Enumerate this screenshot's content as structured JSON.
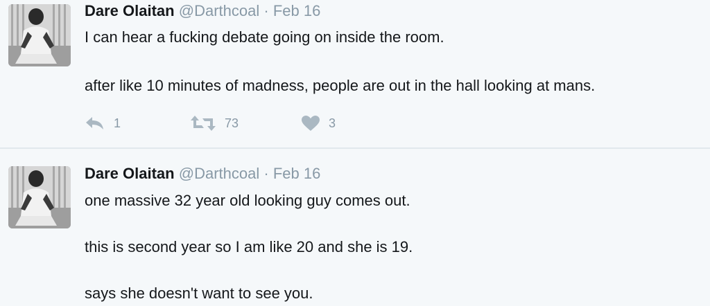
{
  "colors": {
    "background": "#f5f8fa",
    "text": "#14171a",
    "muted": "#8899a6",
    "divider": "#e1e8ed"
  },
  "tweets": [
    {
      "name": "Dare Olaitan",
      "handle": "@Darthcoal",
      "separator": "·",
      "date": "Feb 16",
      "lines": [
        "I can hear a fucking debate going on inside the room.",
        "after like 10 minutes of madness, people are out in the hall looking at mans."
      ],
      "actions": {
        "reply_icon": "reply-icon",
        "reply_count": "1",
        "retweet_icon": "retweet-icon",
        "retweet_count": "73",
        "like_icon": "heart-icon",
        "like_count": "3"
      }
    },
    {
      "name": "Dare Olaitan",
      "handle": "@Darthcoal",
      "separator": "·",
      "date": "Feb 16",
      "lines": [
        "one massive 32 year old looking guy comes out.",
        "this is second year so I am like 20 and she is 19.",
        "says she doesn't want to see you."
      ]
    }
  ]
}
